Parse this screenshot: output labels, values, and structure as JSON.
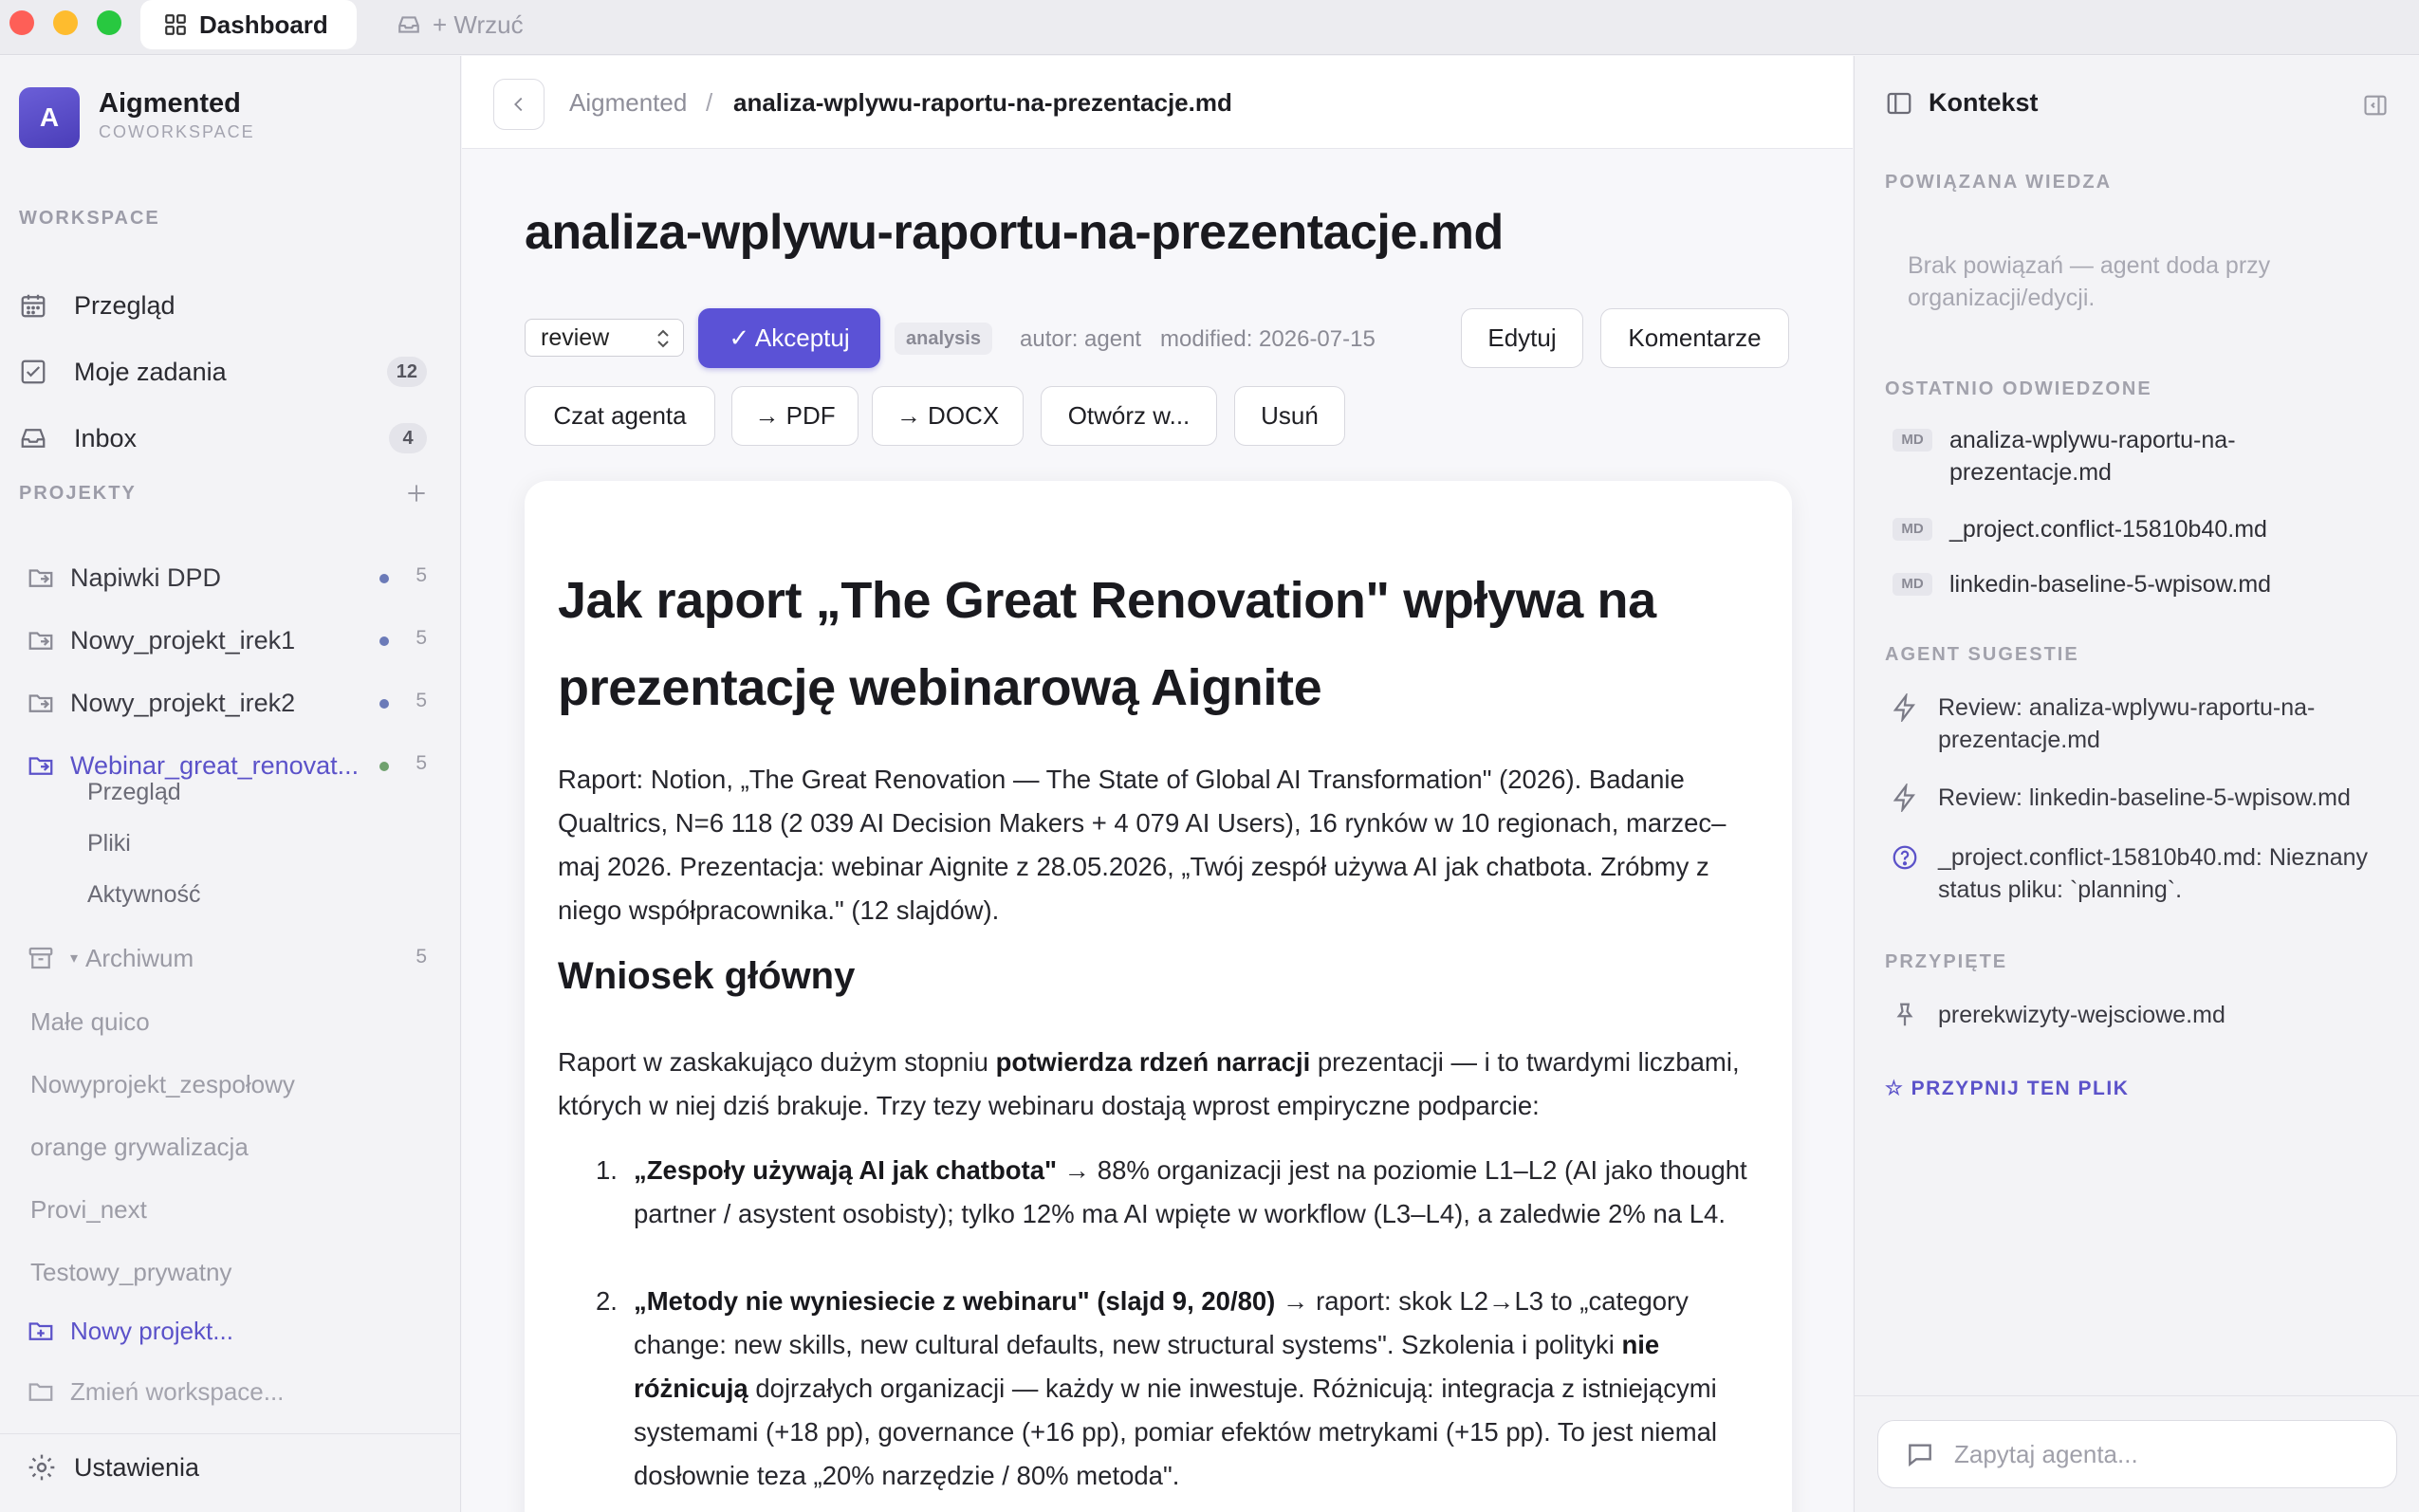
{
  "titlebar": {
    "tabs": [
      {
        "label": "Dashboard",
        "icon": "grid-icon"
      },
      {
        "label": "+ Wrzuć",
        "icon": "inbox-tray-icon"
      }
    ]
  },
  "sidebar": {
    "brand": {
      "initial": "A",
      "name": "Aigmented",
      "subtitle": "COWORKSPACE"
    },
    "workspace_label": "WORKSPACE",
    "workspace_items": [
      {
        "label": "Przegląd",
        "icon": "calendar-icon",
        "badge": ""
      },
      {
        "label": "Moje zadania",
        "icon": "checkbox-icon",
        "badge": "12"
      },
      {
        "label": "Inbox",
        "icon": "inbox-icon",
        "badge": "4"
      }
    ],
    "projects_label": "PROJEKTY",
    "projects": [
      {
        "label": "Napiwki DPD",
        "count": "5"
      },
      {
        "label": "Nowy_projekt_irek1",
        "count": "5"
      },
      {
        "label": "Nowy_projekt_irek2",
        "count": "5"
      },
      {
        "label": "Webinar_great_renovat...",
        "count": "5",
        "active": true
      }
    ],
    "project_subitems": [
      "Przegląd",
      "Pliki",
      "Aktywność"
    ],
    "archive": {
      "label": "Archiwum",
      "count": "5"
    },
    "archived_projects": [
      "Małe quico",
      "Nowyprojekt_zespołowy",
      "orange grywalizacja",
      "Provi_next",
      "Testowy_prywatny"
    ],
    "new_project": "Nowy projekt...",
    "switch_workspace": "Zmień workspace...",
    "settings": "Ustawienia"
  },
  "main": {
    "breadcrumb": {
      "root": "Aigmented",
      "separator": "/",
      "current": "analiza-wplywu-raportu-na-prezentacje.md"
    },
    "title": "analiza-wplywu-raportu-na-prezentacje.md",
    "status": {
      "value": "review",
      "options": [
        "review"
      ]
    },
    "accept_label": "✓ Akceptuj",
    "tag": "analysis",
    "author": "autor: agent",
    "modified": "modified: 2026-07-15",
    "edit_label": "Edytuj",
    "comments_label": "Komentarze",
    "actions": [
      "Czat agenta",
      "→ PDF",
      "→ DOCX",
      "Otwórz w...",
      "Usuń"
    ],
    "doc": {
      "h1": "Jak raport „The Great Renovation\" wpływa na prezentację webinarową Aignite",
      "intro": "Raport: Notion, „The Great Renovation — The State of Global AI Transformation\" (2026). Badanie Qualtrics, N=6 118 (2 039 AI Decision Makers + 4 079 AI Users), 16 rynków w 10 regionach, marzec–maj 2026. Prezentacja: webinar Aignite z 28.05.2026, „Twój zespół używa AI jak chatbota. Zróbmy z niego współpracownika.\" (12 slajdów).",
      "h2": "Wniosek główny",
      "p2_a": "Raport w zaskakująco dużym stopniu ",
      "p2_b": "potwierdza rdzeń narracji",
      "p2_c": " prezentacji — i to twardymi liczbami, których w niej dziś brakuje. Trzy tezy webinaru dostają wprost empiryczne podparcie:",
      "list": [
        {
          "num": "1.",
          "bold": "„Zespoły używają AI jak chatbota\"",
          "text": " → 88% organizacji jest na poziomie L1–L2 (AI jako thought partner / asystent osobisty); tylko 12% ma AI wpięte w workflow (L3–L4), a zaledwie 2% na L4."
        },
        {
          "num": "2.",
          "bold": "„Metody nie wyniesiecie z webinaru\" (slajd 9, 20/80)",
          "text_a": " → raport: skok L2→L3 to „category change: new skills, new cultural defaults, new structural systems\". Szkolenia i polityki ",
          "bold2": "nie różnicują",
          "text_b": " dojrzałych organizacji — każdy w nie inwestuje. Różnicują: integracja z istniejącymi systemami (+18 pp), governance (+16 pp), pomiar efektów metrykami (+15 pp). To jest niemal dosłownie teza „20% narzędzie / 80% metoda\"."
        }
      ]
    }
  },
  "context_panel": {
    "title": "Kontekst",
    "related_label": "POWIĄZANA WIEDZA",
    "related_empty": "Brak powiązań — agent doda przy organizacji/edycji.",
    "recent_label": "OSTATNIO ODWIEDZONE",
    "recent": [
      {
        "badge": "MD",
        "name": "analiza-wplywu-raportu-na-prezentacje.md"
      },
      {
        "badge": "MD",
        "name": "_project.conflict-15810b40.md"
      },
      {
        "badge": "MD",
        "name": "linkedin-baseline-5-wpisow.md"
      }
    ],
    "suggestions_label": "AGENT SUGESTIE",
    "suggestions": [
      {
        "icon": "bolt-icon",
        "text": "Review: analiza-wplywu-raportu-na-prezentacje.md"
      },
      {
        "icon": "bolt-icon",
        "text": "Review: linkedin-baseline-5-wpisow.md"
      },
      {
        "icon": "question-circle-icon",
        "text": "_project.conflict-15810b40.md: Nieznany status pliku: `planning`."
      }
    ],
    "pinned_label": "PRZYPIĘTE",
    "pinned": [
      {
        "icon": "pin-icon",
        "name": "prerekwizyty-wejsciowe.md"
      }
    ],
    "pin_button": "☆ PRZYPNIJ TEN PLIK",
    "ask_placeholder": "Zapytaj agenta..."
  },
  "colors": {
    "accent": "#5b52d6",
    "active_project_dot": "#6fa16e",
    "project_dot": "#6b7ab8"
  }
}
